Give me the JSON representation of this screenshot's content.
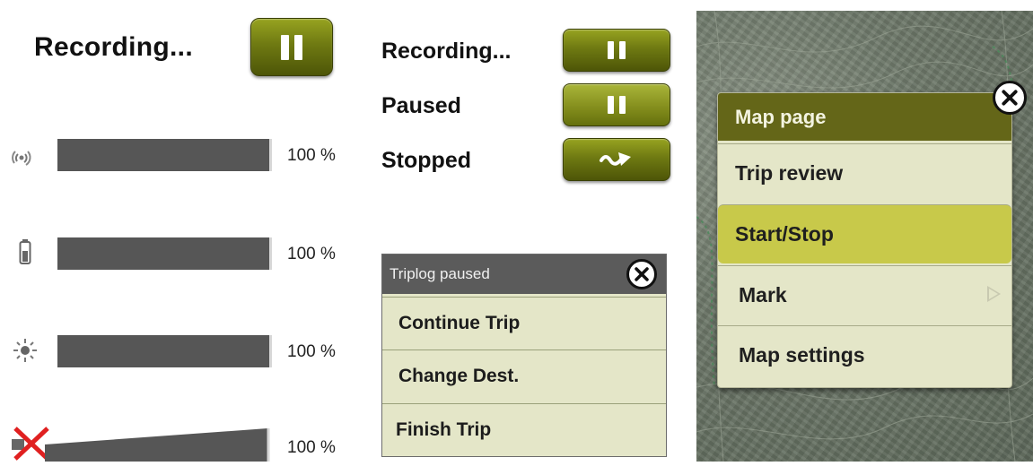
{
  "panel1": {
    "title": "Recording...",
    "rows": [
      {
        "icon": "gps-signal-icon",
        "percent": "100 %",
        "level": 1.0
      },
      {
        "icon": "battery-icon",
        "percent": "100 %",
        "level": 1.0
      },
      {
        "icon": "brightness-icon",
        "percent": "100 %",
        "level": 1.0
      },
      {
        "icon": "volume-muted-icon",
        "percent": "100 %",
        "level": 1.0
      }
    ]
  },
  "panel2": {
    "states": [
      {
        "label": "Recording...",
        "icon": "pause-icon"
      },
      {
        "label": "Paused",
        "icon": "pause-icon"
      },
      {
        "label": "Stopped",
        "icon": "go-arrow-icon"
      }
    ],
    "triplog": {
      "title": "Triplog paused",
      "items": [
        "Continue Trip",
        "Change Dest.",
        "Finish Trip"
      ]
    }
  },
  "panel3": {
    "menu": {
      "title": "Map page",
      "items": [
        {
          "label": "Trip review"
        },
        {
          "label": "Start/Stop"
        },
        {
          "label": "Mark"
        },
        {
          "label": "Map settings"
        }
      ]
    }
  },
  "colors": {
    "olive_button": "#6f7a12",
    "menu_background": "#e4e6c8",
    "menu_header": "#646618",
    "highlight": "#c8c94a",
    "level_bar": "#565656",
    "mute_cross": "#e02020"
  }
}
